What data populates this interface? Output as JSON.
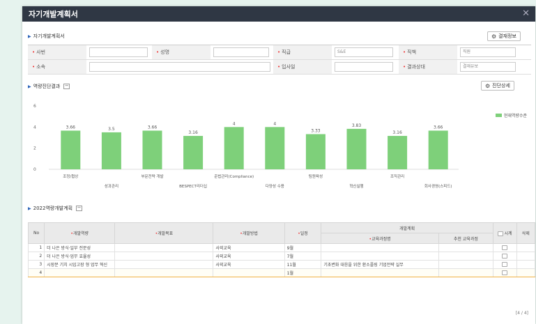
{
  "window": {
    "title": "자기개발계획서",
    "close_glyph": "✕"
  },
  "section1": {
    "title": "자기개발계획서",
    "button_label": "결재정보",
    "fields": {
      "name": {
        "label": "사번",
        "value": ""
      },
      "rank": {
        "label": "성명",
        "value": ""
      },
      "grade": {
        "label": "직급",
        "value": "S&E"
      },
      "duty": {
        "label": "직책",
        "value": "직원"
      },
      "dept": {
        "label": "소속",
        "value": ""
      },
      "hire_date": {
        "label": "입사일",
        "value": ""
      },
      "result": {
        "label": "결과상대",
        "value": "결재유보"
      }
    }
  },
  "section2": {
    "title": "역량진단결과",
    "toggle": "−",
    "button_label": "진단상세"
  },
  "chart_data": {
    "type": "bar",
    "categories": [
      "조정/협상",
      "성과관리",
      "부문전략 개발",
      "BESPECT리더십",
      "준법관리(Compliance)",
      "다양성 수용",
      "팀원육성",
      "혁신실행",
      "조직관리",
      "회사경영(스피드)"
    ],
    "values": [
      3.66,
      3.5,
      3.66,
      3.16,
      4,
      4,
      3.33,
      3.83,
      3.16,
      3.66
    ],
    "data_labels": [
      "3.66",
      "3.5",
      "3.66",
      "3.16",
      "4",
      "4",
      "3.33",
      "3.83",
      "3.16",
      "3.66"
    ],
    "series": [
      {
        "name": "현재역량수준",
        "values": [
          3.66,
          3.5,
          3.66,
          3.16,
          4,
          4,
          3.33,
          3.83,
          3.16,
          3.66
        ]
      }
    ],
    "ylim": [
      0,
      6
    ],
    "yticks": [
      "0",
      "2",
      "4",
      "6"
    ],
    "color": "#7ed07a",
    "legend_position": "top-right"
  },
  "section3": {
    "title": "2022역량개발계획",
    "toggle": "−",
    "headers": {
      "no": "No",
      "item": "개발역량",
      "goal": "개발목표",
      "method": "개발방법",
      "schedule": "일정",
      "plan": "개발계획",
      "course": "교육과정명",
      "recommend": "추천 교육과정",
      "cert": "시계",
      "del": "삭제"
    },
    "rows": [
      {
        "no": "1",
        "item": "더 나은 방식·일부 전문성",
        "goal": "",
        "method": "사외교육",
        "schedule": "9월",
        "course": "",
        "recommend": ""
      },
      {
        "no": "2",
        "item": "더 나은 방식·업무 효율성",
        "goal": "",
        "method": "사외교육",
        "schedule": "7월",
        "course": "",
        "recommend": ""
      },
      {
        "no": "3",
        "item": "시장분 기치 시입고장 형 업무 혁신",
        "goal": "",
        "method": "사외교육",
        "schedule": "11월",
        "course": "기초변화 대응을 위한 환소플링 기업전략 실무",
        "recommend": ""
      },
      {
        "no": "4",
        "item": "",
        "goal": "",
        "method": "",
        "schedule": "1월",
        "course": "",
        "recommend": ""
      }
    ],
    "pager": "[4 / 4]"
  }
}
